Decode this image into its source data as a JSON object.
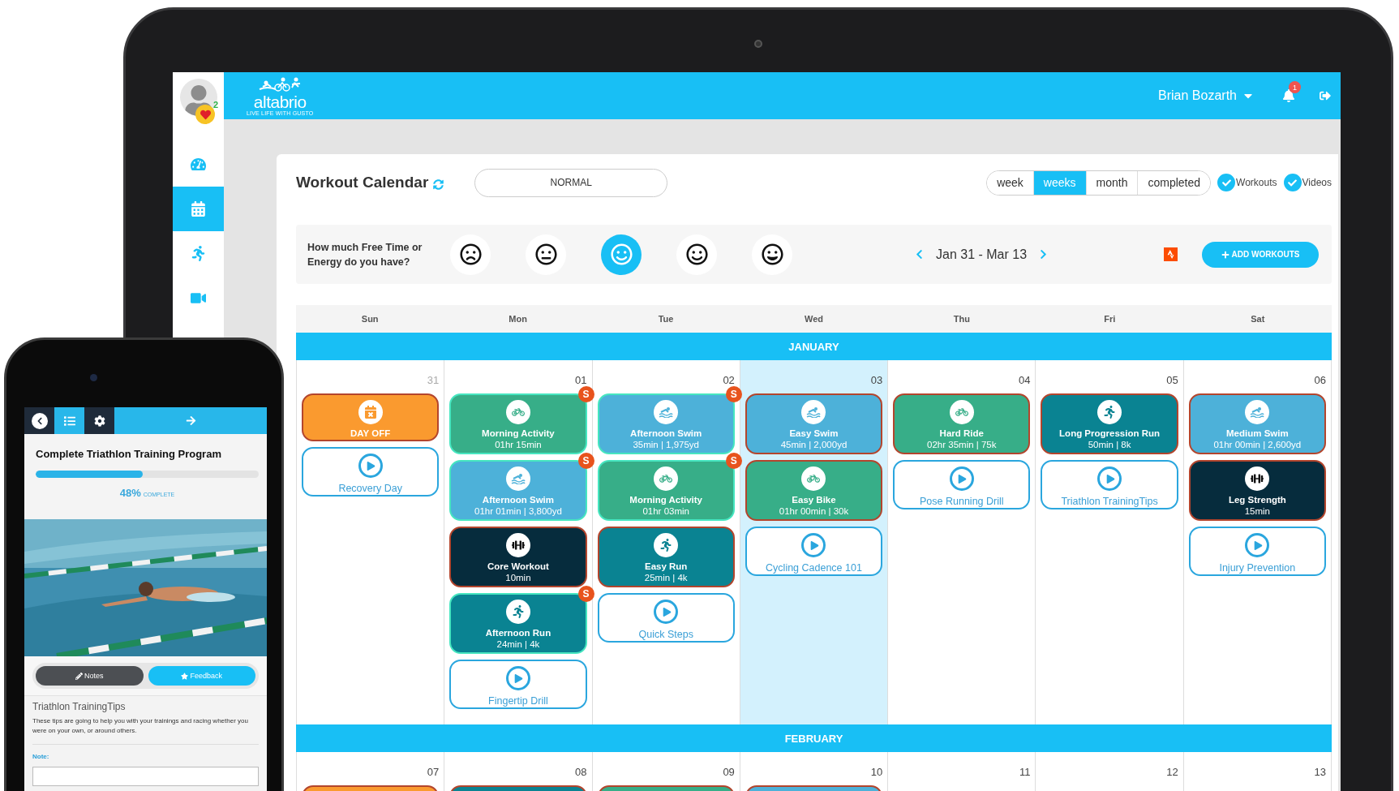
{
  "header": {
    "logo": "altabrio",
    "tagline": "LIVE LIFE WITH GUSTO",
    "user": "Brian Bozarth",
    "notifications": "1"
  },
  "sidebar": {
    "likes": "2",
    "items": [
      {
        "selected": false
      },
      {
        "selected": true
      },
      {
        "selected": false
      },
      {
        "selected": false
      }
    ]
  },
  "toolbar": {
    "title": "Workout Calendar",
    "plan": "NORMAL",
    "views": [
      {
        "label": "week",
        "selected": false
      },
      {
        "label": "weeks",
        "selected": true
      },
      {
        "label": "month",
        "selected": false
      },
      {
        "label": "completed",
        "selected": false
      }
    ],
    "filters": [
      {
        "label": "Workouts",
        "checked": true
      },
      {
        "label": "Videos",
        "checked": true
      }
    ]
  },
  "energy": {
    "question": "How much Free Time or Energy do you have?",
    "moods": [
      {
        "kind": "frown",
        "selected": false
      },
      {
        "kind": "meh",
        "selected": false
      },
      {
        "kind": "smile",
        "selected": true
      },
      {
        "kind": "smile",
        "selected": false
      },
      {
        "kind": "grin",
        "selected": false
      }
    ],
    "range": "Jan 31 - Mar 13",
    "add_button": "ADD WORKOUTS"
  },
  "calendar": {
    "day_names": [
      "Sun",
      "Mon",
      "Tue",
      "Wed",
      "Thu",
      "Fri",
      "Sat"
    ],
    "months": [
      {
        "name": "JANUARY",
        "days": [
          {
            "date": "31",
            "muted": true,
            "today": false,
            "items": [
              {
                "kind": "dayoff",
                "title": "DAY OFF",
                "synced": false
              },
              {
                "kind": "video",
                "title": "Recovery Day"
              }
            ]
          },
          {
            "date": "01",
            "muted": false,
            "today": false,
            "items": [
              {
                "kind": "bike",
                "title": "Morning Activity",
                "detail": "01hr 15min",
                "synced": true,
                "badge": "S"
              },
              {
                "kind": "swim",
                "title": "Afternoon Swim",
                "detail": "01hr 01min | 3,800yd",
                "synced": true,
                "badge": "S"
              },
              {
                "kind": "strength",
                "title": "Core Workout",
                "detail": "10min",
                "synced": false
              },
              {
                "kind": "run",
                "title": "Afternoon Run",
                "detail": "24min | 4k",
                "synced": true,
                "badge": "S"
              },
              {
                "kind": "video",
                "title": "Fingertip Drill"
              }
            ]
          },
          {
            "date": "02",
            "muted": false,
            "today": false,
            "items": [
              {
                "kind": "swim",
                "title": "Afternoon Swim",
                "detail": "35min | 1,975yd",
                "synced": true,
                "badge": "S"
              },
              {
                "kind": "bike",
                "title": "Morning Activity",
                "detail": "01hr 03min",
                "synced": true,
                "badge": "S"
              },
              {
                "kind": "run",
                "title": "Easy Run",
                "detail": "25min | 4k",
                "synced": false
              },
              {
                "kind": "video",
                "title": "Quick Steps"
              }
            ]
          },
          {
            "date": "03",
            "muted": false,
            "today": true,
            "items": [
              {
                "kind": "swim",
                "title": "Easy Swim",
                "detail": "45min | 2,000yd",
                "synced": false
              },
              {
                "kind": "bike",
                "title": "Easy Bike",
                "detail": "01hr 00min | 30k",
                "synced": false
              },
              {
                "kind": "video",
                "title": "Cycling Cadence 101"
              }
            ]
          },
          {
            "date": "04",
            "muted": false,
            "today": false,
            "items": [
              {
                "kind": "bike",
                "title": "Hard Ride",
                "detail": "02hr 35min | 75k",
                "synced": false
              },
              {
                "kind": "video",
                "title": "Pose Running Drill"
              }
            ]
          },
          {
            "date": "05",
            "muted": false,
            "today": false,
            "items": [
              {
                "kind": "run",
                "title": "Long Progression Run",
                "detail": "50min | 8k",
                "synced": false
              },
              {
                "kind": "video",
                "title": "Triathlon TrainingTips"
              }
            ]
          },
          {
            "date": "06",
            "muted": false,
            "today": false,
            "items": [
              {
                "kind": "swim",
                "title": "Medium Swim",
                "detail": "01hr 00min | 2,600yd",
                "synced": false
              },
              {
                "kind": "strength",
                "title": "Leg Strength",
                "detail": "15min",
                "synced": false
              },
              {
                "kind": "video",
                "title": "Injury Prevention"
              }
            ]
          }
        ]
      },
      {
        "name": "FEBRUARY",
        "days": [
          {
            "date": "07",
            "muted": false,
            "today": false,
            "items": [
              {
                "kind": "dayoff",
                "synced": false
              }
            ]
          },
          {
            "date": "08",
            "muted": false,
            "today": false,
            "items": [
              {
                "kind": "run",
                "synced": false
              }
            ]
          },
          {
            "date": "09",
            "muted": false,
            "today": false,
            "items": [
              {
                "kind": "bike",
                "synced": false
              }
            ]
          },
          {
            "date": "10",
            "muted": false,
            "today": false,
            "items": [
              {
                "kind": "swim",
                "synced": false
              }
            ]
          },
          {
            "date": "11",
            "muted": false,
            "today": false
          },
          {
            "date": "12",
            "muted": false,
            "today": false
          },
          {
            "date": "13",
            "muted": false,
            "today": false
          }
        ]
      }
    ]
  },
  "phone": {
    "nav": [
      {
        "selected": false
      },
      {
        "selected": true
      },
      {
        "selected": false
      }
    ],
    "title": "Complete Triathlon Training Program",
    "progress": {
      "level": 0.48,
      "percent": "48%",
      "label": "COMPLETE"
    },
    "buttons": [
      {
        "kind": "dark",
        "label": "Notes"
      },
      {
        "kind": "primary",
        "label": "Feedback"
      }
    ],
    "heading": "Triathlon TrainingTips",
    "body": "These tips are going to help you with your trainings and racing whether you were on your own, or around others.",
    "note_label": "Note:"
  }
}
